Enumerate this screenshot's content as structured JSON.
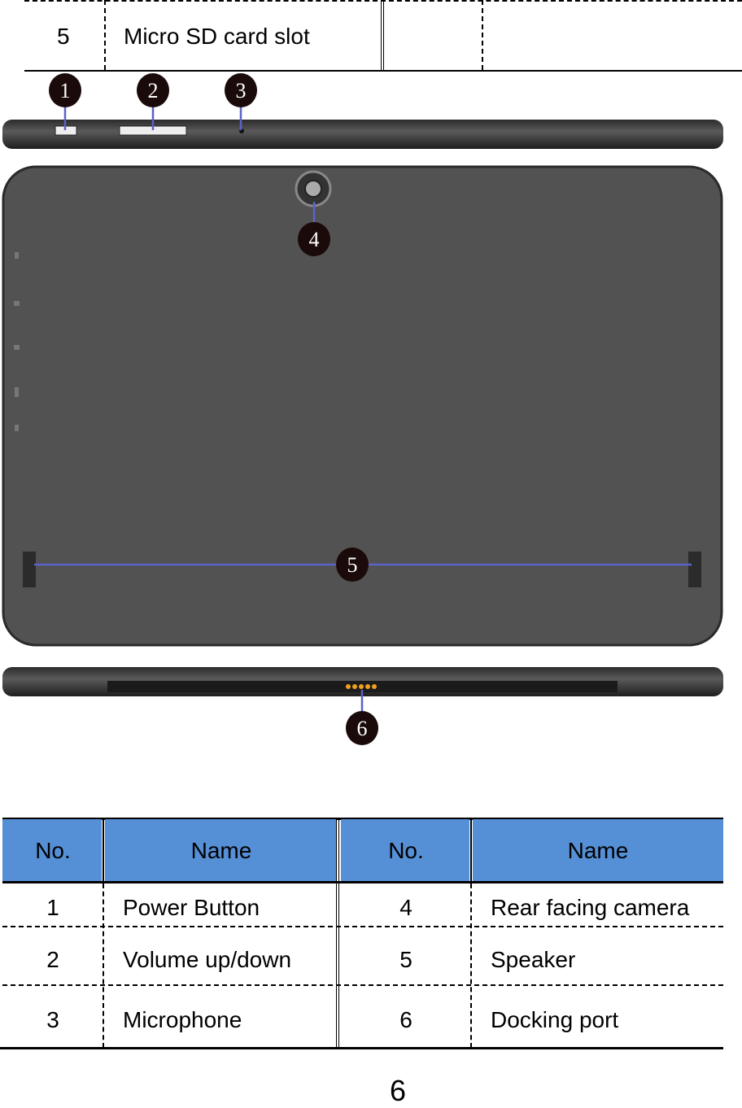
{
  "top_row": {
    "no": "5",
    "name": "Micro SD card slot"
  },
  "callouts": [
    "1",
    "2",
    "3",
    "4",
    "5",
    "6"
  ],
  "table": {
    "headers": [
      "No.",
      "Name",
      "No.",
      "Name"
    ],
    "header_color": "#558fd5",
    "rows": [
      {
        "no1": "1",
        "name1": "Power Button",
        "no2": "4",
        "name2": "Rear facing camera"
      },
      {
        "no1": "2",
        "name1": "Volume up/down",
        "no2": "5",
        "name2": "Speaker"
      },
      {
        "no1": "3",
        "name1": "Microphone",
        "no2": "6",
        "name2": "Docking port"
      }
    ]
  },
  "page_number": "6"
}
